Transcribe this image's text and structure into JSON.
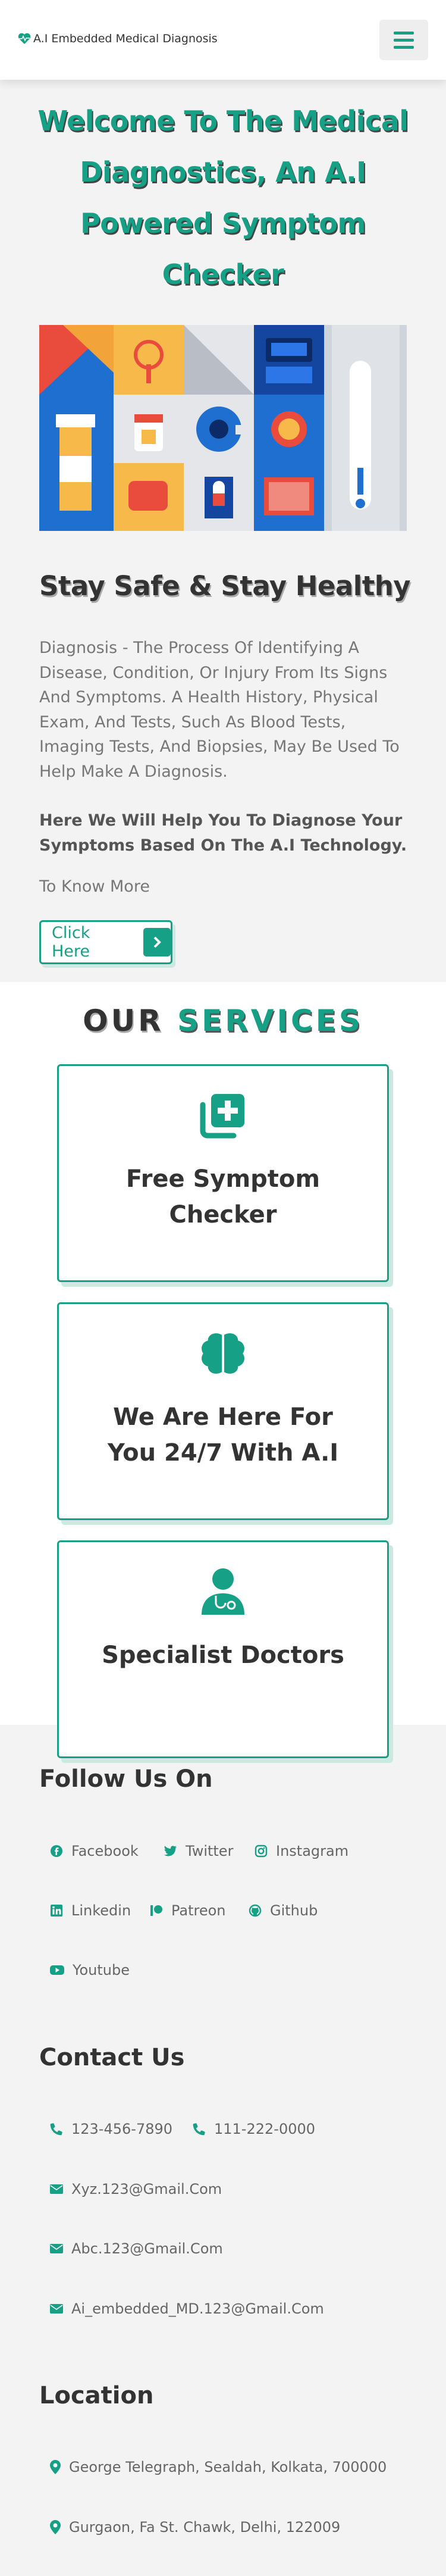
{
  "header": {
    "logo_text": "A.I Embedded Medical Diagnosis",
    "menu_icon": "bars-icon"
  },
  "hero": {
    "title": "Welcome To The Medical Diagnostics, An A.I Powered Symptom Checker",
    "subtitle": "Stay Safe & Stay Healthy",
    "paragraph": "Diagnosis - The Process Of Identifying A Disease, Condition, Or Injury From Its Signs And Symptoms. A Health History, Physical Exam, And Tests, Such As Blood Tests, Imaging Tests, And Biopsies, May Be Used To Help Make A Diagnosis.",
    "help_text": "Here We Will Help You To Diagnose Your Symptoms Based On The A.I Technology.",
    "know_more": "To Know More",
    "cta_label": "Click Here"
  },
  "services": {
    "title_a": "OUR",
    "title_b": "SERVICES",
    "cards": [
      {
        "label": "Free Symptom Checker",
        "icon": "notes-medical-icon"
      },
      {
        "label": "We Are Here For You 24/7 With A.I",
        "icon": "brain-icon"
      },
      {
        "label": "Specialist Doctors",
        "icon": "doctor-icon"
      }
    ]
  },
  "follow": {
    "title": "Follow Us On",
    "links": [
      "Facebook",
      "Twitter",
      "Instagram",
      "Linkedin",
      "Patreon",
      "Github",
      "Youtube"
    ]
  },
  "contact": {
    "title": "Contact Us",
    "phone1": "123-456-7890",
    "phone2": "111-222-0000",
    "emails": [
      "Xyz.123@Gmail.Com",
      "Abc.123@Gmail.Com",
      "Ai_embedded_MD.123@Gmail.Com"
    ]
  },
  "location": {
    "title": "Location",
    "addresses": [
      "George Telegraph, Sealdah, Kolkata, 700000",
      "Gurgaon, Fa St. Chawk, Delhi, 122009"
    ]
  },
  "colors": {
    "accent": "#16a085",
    "text": "#333333",
    "muted": "#777777"
  }
}
